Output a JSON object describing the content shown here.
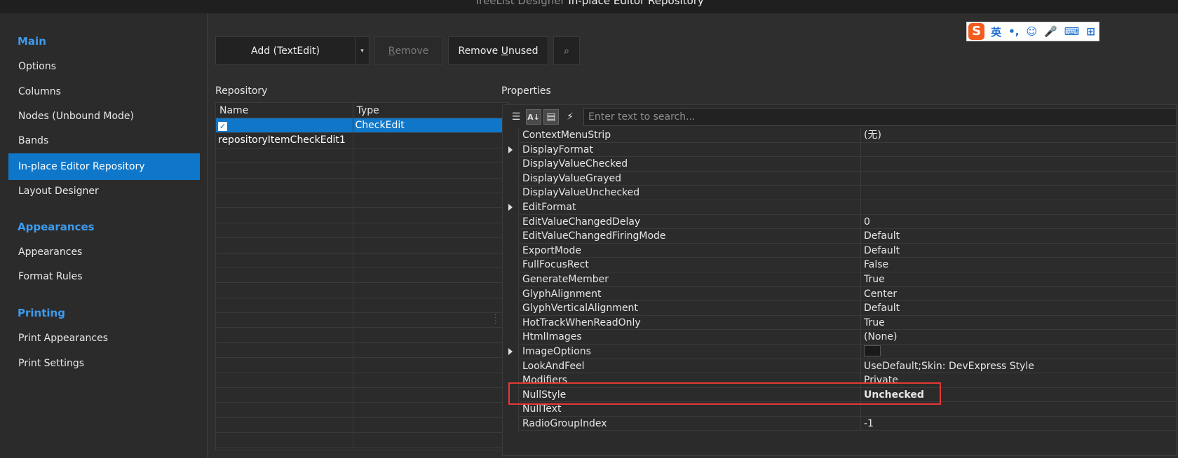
{
  "window": {
    "title_prefix": "TreeList Designer",
    "title_main": "In-place Editor Repository"
  },
  "sidebar": {
    "groups": [
      {
        "label": "Main",
        "items": [
          "Options",
          "Columns",
          "Nodes (Unbound Mode)",
          "Bands",
          "In-place Editor Repository",
          "Layout Designer"
        ]
      },
      {
        "label": "Appearances",
        "items": [
          "Appearances",
          "Format Rules"
        ]
      },
      {
        "label": "Printing",
        "items": [
          "Print Appearances",
          "Print Settings"
        ]
      }
    ],
    "active_item": "In-place Editor Repository"
  },
  "toolbar": {
    "add_label": "Add (TextEdit)",
    "add_dropdown_glyph": "▾",
    "remove_label_pre": "",
    "remove_label_u": "R",
    "remove_label_post": "emove",
    "remove_unused_pre": "Remove ",
    "remove_unused_u": "U",
    "remove_unused_post": "nused",
    "search_glyph": "⌕"
  },
  "repository": {
    "label": "Repository",
    "columns": [
      "Name",
      "Type"
    ],
    "rows": [
      {
        "name": "repositoryItemCheckEdit1",
        "type": "CheckEdit",
        "selected": true
      }
    ],
    "check_glyph": "✓"
  },
  "properties": {
    "label": "Properties",
    "search_placeholder": "Enter text to search...",
    "toolbar_icons": [
      "categorized-icon",
      "alphabetical-icon",
      "property-pages-icon",
      "events-icon"
    ],
    "toolbar_glyphs": [
      "☰",
      "A↓",
      "▤",
      "⚡"
    ],
    "rows": [
      {
        "name": "ContextMenuStrip",
        "value": "(无)",
        "expandable": false
      },
      {
        "name": "DisplayFormat",
        "value": "",
        "expandable": true
      },
      {
        "name": "DisplayValueChecked",
        "value": "",
        "expandable": false
      },
      {
        "name": "DisplayValueGrayed",
        "value": "",
        "expandable": false
      },
      {
        "name": "DisplayValueUnchecked",
        "value": "",
        "expandable": false
      },
      {
        "name": "EditFormat",
        "value": "",
        "expandable": true
      },
      {
        "name": "EditValueChangedDelay",
        "value": "0",
        "expandable": false
      },
      {
        "name": "EditValueChangedFiringMode",
        "value": "Default",
        "expandable": false
      },
      {
        "name": "ExportMode",
        "value": "Default",
        "expandable": false
      },
      {
        "name": "FullFocusRect",
        "value": "False",
        "expandable": false
      },
      {
        "name": "GenerateMember",
        "value": "True",
        "expandable": false
      },
      {
        "name": "GlyphAlignment",
        "value": "Center",
        "expandable": false
      },
      {
        "name": "GlyphVerticalAlignment",
        "value": "Default",
        "expandable": false
      },
      {
        "name": "HotTrackWhenReadOnly",
        "value": "True",
        "expandable": false
      },
      {
        "name": "HtmlImages",
        "value": "(None)",
        "expandable": false
      },
      {
        "name": "ImageOptions",
        "value": "",
        "expandable": true,
        "swatch": true
      },
      {
        "name": "LookAndFeel",
        "value": "UseDefault;Skin: DevExpress Style",
        "expandable": false
      },
      {
        "name": "Modifiers",
        "value": "Private",
        "expandable": false
      },
      {
        "name": "NullStyle",
        "value": "Unchecked",
        "expandable": false,
        "bold": true
      },
      {
        "name": "NullText",
        "value": "",
        "expandable": false
      },
      {
        "name": "RadioGroupIndex",
        "value": "-1",
        "expandable": false
      }
    ]
  },
  "ime": {
    "logo": "S",
    "items": [
      "英",
      "•,",
      "☺",
      "🎤",
      "⌨",
      "⊞"
    ]
  },
  "colors": {
    "accent": "#0f77c9",
    "group_label": "#3d9bef",
    "highlight": "#e53935"
  }
}
